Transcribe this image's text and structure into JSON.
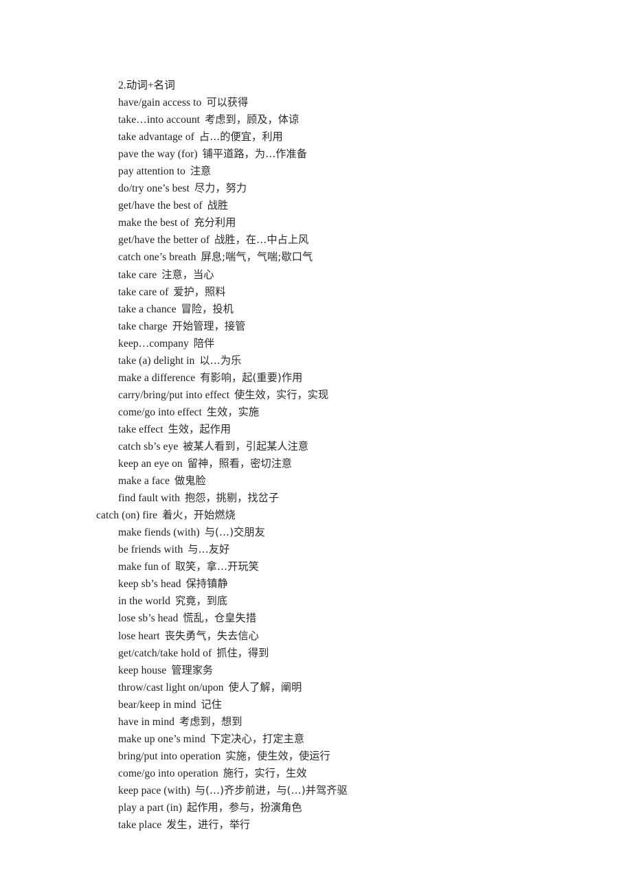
{
  "document": {
    "heading": "2.动词+名词",
    "entries": [
      {
        "phrase": "have/gain access to",
        "gloss": "可以获得",
        "outdented": false
      },
      {
        "phrase": "take…into account",
        "gloss": "考虑到，顾及，体谅",
        "outdented": false
      },
      {
        "phrase": "take advantage of",
        "gloss": "占…的便宜，利用",
        "outdented": false
      },
      {
        "phrase": "pave the way (for)",
        "gloss": "铺平道路，为…作准备",
        "outdented": false
      },
      {
        "phrase": "pay attention to",
        "gloss": "注意",
        "outdented": false
      },
      {
        "phrase": "do/try one’s best",
        "gloss": "尽力，努力",
        "outdented": false
      },
      {
        "phrase": "get/have the best of",
        "gloss": "战胜",
        "outdented": false
      },
      {
        "phrase": "make the best of",
        "gloss": "充分利用",
        "outdented": false
      },
      {
        "phrase": "get/have the better of",
        "gloss": "战胜，在…中占上风",
        "outdented": false
      },
      {
        "phrase": "catch one’s breath",
        "gloss": "屏息;喘气，气喘;歇口气",
        "outdented": false
      },
      {
        "phrase": "take care",
        "gloss": "注意，当心",
        "outdented": false
      },
      {
        "phrase": "take care of",
        "gloss": "爱护，照料",
        "outdented": false
      },
      {
        "phrase": "take a chance",
        "gloss": "冒险，投机",
        "outdented": false
      },
      {
        "phrase": "take charge",
        "gloss": "开始管理，接管",
        "outdented": false
      },
      {
        "phrase": "keep…company",
        "gloss": "陪伴",
        "outdented": false
      },
      {
        "phrase": "take (a) delight in",
        "gloss": "以…为乐",
        "outdented": false
      },
      {
        "phrase": "make a difference",
        "gloss": "有影响，起(重要)作用",
        "outdented": false
      },
      {
        "phrase": "carry/bring/put into effect",
        "gloss": "使生效，实行，实现",
        "outdented": false
      },
      {
        "phrase": "come/go into effect",
        "gloss": "生效，实施",
        "outdented": false
      },
      {
        "phrase": "take effect",
        "gloss": "生效，起作用",
        "outdented": false
      },
      {
        "phrase": "catch sb’s eye",
        "gloss": "被某人看到，引起某人注意",
        "outdented": false
      },
      {
        "phrase": "keep an eye on",
        "gloss": "留神，照看，密切注意",
        "outdented": false
      },
      {
        "phrase": "make a face",
        "gloss": "做鬼脸",
        "outdented": false
      },
      {
        "phrase": "find fault with",
        "gloss": "抱怨，挑剔，找岔子",
        "outdented": false
      },
      {
        "phrase": "catch (on) fire",
        "gloss": "着火，开始燃烧",
        "outdented": true
      },
      {
        "phrase": "make fiends (with)",
        "gloss": "与(…)交朋友",
        "outdented": false
      },
      {
        "phrase": "be friends with",
        "gloss": "与…友好",
        "outdented": false
      },
      {
        "phrase": "make fun of",
        "gloss": "取笑，拿…开玩笑",
        "outdented": false
      },
      {
        "phrase": "keep sb’s head",
        "gloss": "保持镇静",
        "outdented": false
      },
      {
        "phrase": "in the world",
        "gloss": "究竟，到底",
        "outdented": false
      },
      {
        "phrase": "lose sb’s head",
        "gloss": "慌乱，仓皇失措",
        "outdented": false
      },
      {
        "phrase": "lose heart",
        "gloss": "丧失勇气，失去信心",
        "outdented": false
      },
      {
        "phrase": "get/catch/take hold of",
        "gloss": "抓住，得到",
        "outdented": false
      },
      {
        "phrase": "keep house",
        "gloss": "管理家务",
        "outdented": false
      },
      {
        "phrase": "throw/cast light on/upon",
        "gloss": "使人了解，阐明",
        "outdented": false
      },
      {
        "phrase": "bear/keep in mind",
        "gloss": "记住",
        "outdented": false
      },
      {
        "phrase": "have in mind",
        "gloss": "考虑到，想到",
        "outdented": false
      },
      {
        "phrase": "make up one’s mind",
        "gloss": "下定决心，打定主意",
        "outdented": false
      },
      {
        "phrase": "bring/put into operation",
        "gloss": "实施，使生效，使运行",
        "outdented": false
      },
      {
        "phrase": "come/go into operation",
        "gloss": "施行，实行，生效",
        "outdented": false
      },
      {
        "phrase": "keep pace (with)",
        "gloss": "与(…)齐步前进，与(…)并驾齐驱",
        "outdented": false
      },
      {
        "phrase": "play a part (in)",
        "gloss": "起作用，参与，扮演角色",
        "outdented": false
      },
      {
        "phrase": "take place",
        "gloss": "发生，进行，举行",
        "outdented": false
      }
    ]
  }
}
